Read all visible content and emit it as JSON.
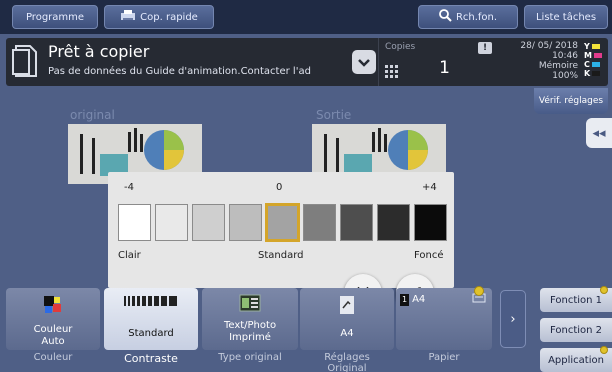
{
  "topbar": {
    "programme": "Programme",
    "copy_quick": "Cop. rapide",
    "search": "Rch.fon.",
    "jobs": "Liste tâches"
  },
  "status": {
    "title": "Prêt à copier",
    "message": "Pas de données du Guide d'animation.Contacter l'ad",
    "copies_label": "Copies",
    "copies_value": "1",
    "date": "28/ 05/ 2018",
    "time": "10:46",
    "memory_label": "Mémoire",
    "memory_value": "100%",
    "toner": [
      "Y",
      "M",
      "C",
      "K"
    ],
    "toner_colors": [
      "#f2e23a",
      "#e23b8c",
      "#2cb0e6",
      "#1a1a1a"
    ]
  },
  "verify_button": "Vérif. réglages",
  "preview": {
    "original_label": "original",
    "output_label": "Sortie"
  },
  "density": {
    "ticks": [
      "-4",
      "0",
      "+4"
    ],
    "levels": [
      "#ffffff",
      "#e9e9e9",
      "#cfcfcf",
      "#bdbdbd",
      "#a3a3a3",
      "#7e7e7e",
      "#4e4e4e",
      "#2c2c2c",
      "#0b0b0b"
    ],
    "selected_index": 4,
    "left_label": "Clair",
    "center_label": "Standard",
    "right_label": "Foncé"
  },
  "tiles": [
    {
      "label": "Couleur\nAuto",
      "caption": "Couleur"
    },
    {
      "label": "Standard",
      "caption": "Contraste"
    },
    {
      "label": "Text/Photo\nImprimé",
      "caption": "Type original"
    },
    {
      "label": "A4",
      "caption": "Réglages\nOriginal"
    },
    {
      "label": "A4",
      "caption": "Papier"
    }
  ],
  "functions": [
    "Fonction 1",
    "Fonction 2",
    "Application"
  ]
}
